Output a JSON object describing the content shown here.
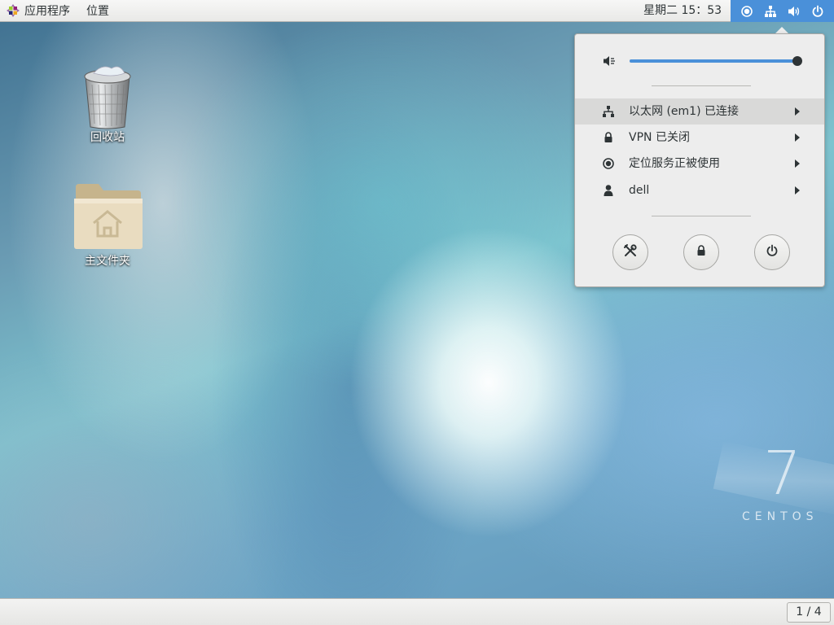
{
  "topbar": {
    "apps_label": "应用程序",
    "places_label": "位置",
    "clock": "星期二 15：53",
    "status_icons": [
      "location-icon",
      "network-wired-icon",
      "volume-icon",
      "power-icon"
    ]
  },
  "desktop": {
    "icons": [
      {
        "label": "回收站",
        "icon": "trash-icon"
      },
      {
        "label": "主文件夹",
        "icon": "home-folder-icon"
      }
    ]
  },
  "system_menu": {
    "volume": {
      "level": 0.99,
      "icon": "volume-muted-icon"
    },
    "items": [
      {
        "label": "以太网 (em1) 已连接",
        "icon": "network-wired-icon",
        "highlighted": true
      },
      {
        "label": "VPN 已关闭",
        "icon": "vpn-lock-icon",
        "highlighted": false
      },
      {
        "label": "定位服务正被使用",
        "icon": "location-icon",
        "highlighted": false
      },
      {
        "label": "dell",
        "icon": "user-icon",
        "highlighted": false
      }
    ],
    "buttons": [
      "settings-icon",
      "lock-icon",
      "power-icon"
    ]
  },
  "watermark": {
    "version": "7",
    "name": "CENTOS"
  },
  "bottombar": {
    "workspace": "1 / 4"
  },
  "colors": {
    "accent": "#4a90d9",
    "panel_bg": "#ededed",
    "text": "#2e3436"
  }
}
